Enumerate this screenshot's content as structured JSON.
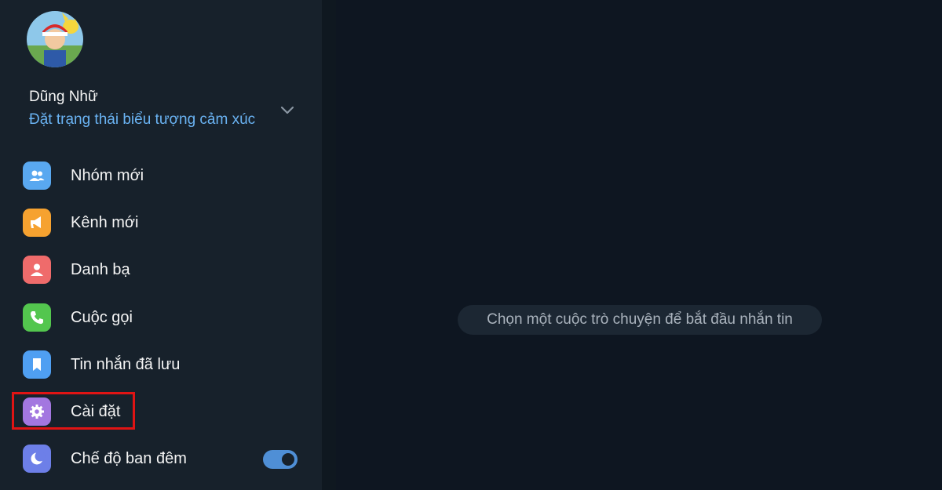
{
  "profile": {
    "name": "Dũng Nhữ",
    "status": "Đặt trạng thái biểu tượng cảm xúc"
  },
  "menu": [
    {
      "label": "Nhóm mới",
      "icon": "group-icon",
      "color": "#59a8f0"
    },
    {
      "label": "Kênh mới",
      "icon": "megaphone-icon",
      "color": "#f6a230"
    },
    {
      "label": "Danh bạ",
      "icon": "contact-icon",
      "color": "#ef6b6b"
    },
    {
      "label": "Cuộc gọi",
      "icon": "phone-icon",
      "color": "#53c64e"
    },
    {
      "label": "Tin nhắn đã lưu",
      "icon": "bookmark-icon",
      "color": "#4f9ff2"
    },
    {
      "label": "Cài đặt",
      "icon": "gear-icon",
      "color": "#a377e0"
    },
    {
      "label": "Chế độ ban đêm",
      "icon": "moon-icon",
      "color": "#6d7fe8"
    }
  ],
  "night_mode_enabled": true,
  "main": {
    "empty_message": "Chọn một cuộc trò chuyện để bắt đầu nhắn tin"
  },
  "colors": {
    "sidebar_bg": "#17212b",
    "main_bg": "#0e1621",
    "accent": "#6ab3f3",
    "highlight_box": "#e01414"
  }
}
